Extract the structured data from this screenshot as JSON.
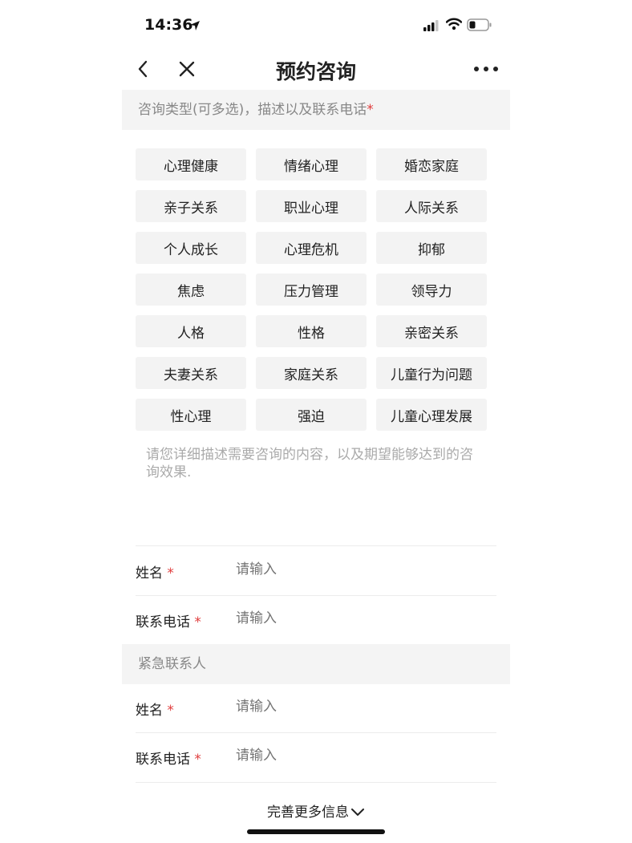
{
  "status_bar": {
    "time": "14:36"
  },
  "nav": {
    "title": "预约咨询"
  },
  "consult_section": {
    "header": "咨询类型(可多选)，描述以及联系电话",
    "required_mark": "*"
  },
  "tags": [
    "心理健康",
    "情绪心理",
    "婚恋家庭",
    "亲子关系",
    "职业心理",
    "人际关系",
    "个人成长",
    "心理危机",
    "抑郁",
    "焦虑",
    "压力管理",
    "领导力",
    "人格",
    "性格",
    "亲密关系",
    "夫妻关系",
    "家庭关系",
    "儿童行为问题",
    "性心理",
    "强迫",
    "儿童心理发展"
  ],
  "description_placeholder": "请您详细描述需要咨询的内容，以及期望能够达到的咨询效果.",
  "contact": {
    "name_label": "姓名",
    "phone_label": "联系电话",
    "required_mark": "*",
    "placeholder": "请输入"
  },
  "emergency": {
    "header": "紧急联系人",
    "name_label": "姓名",
    "phone_label": "联系电话",
    "required_mark": "*",
    "placeholder": "请输入"
  },
  "footer": {
    "more_info": "完善更多信息"
  },
  "colors": {
    "required": "#e03c3c",
    "section_bg": "#f4f4f4",
    "tag_bg": "#f3f3f3"
  }
}
